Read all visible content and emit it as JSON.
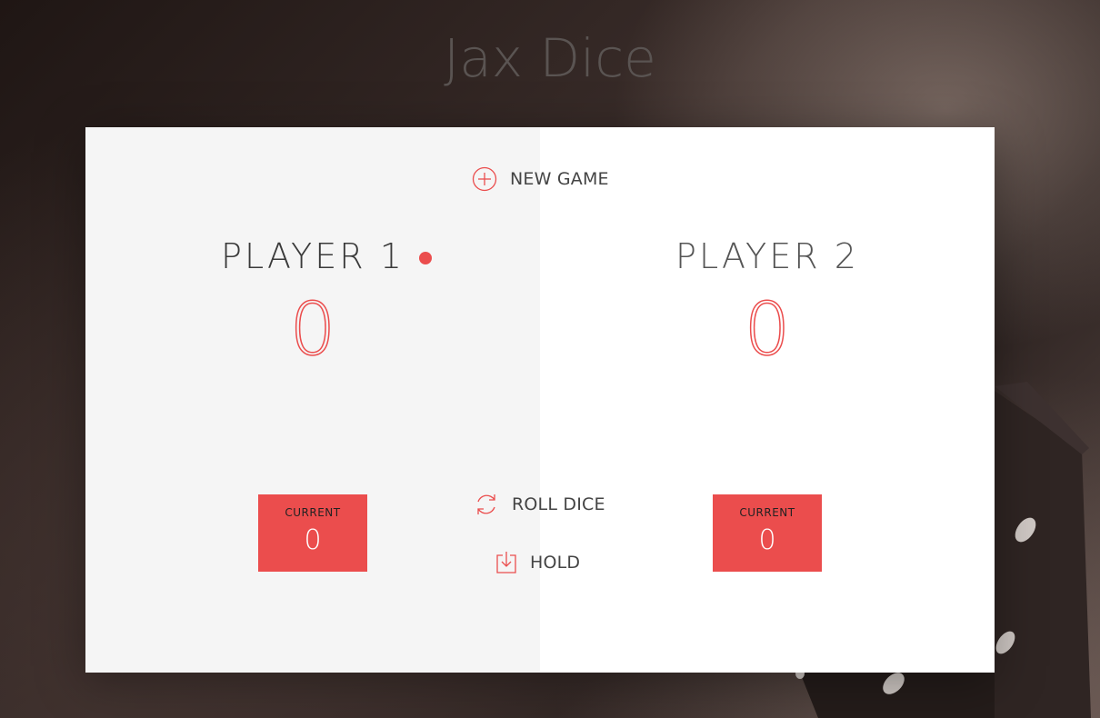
{
  "app": {
    "title": "Jax Dice"
  },
  "controls": {
    "new_game": {
      "label": "NEW GAME",
      "icon": "plus-circle-icon"
    },
    "roll_dice": {
      "label": "ROLL DICE",
      "icon": "refresh-icon"
    },
    "hold": {
      "label": "HOLD",
      "icon": "download-icon"
    }
  },
  "players": [
    {
      "name": "PLAYER 1",
      "score": "0",
      "current_label": "CURRENT",
      "current_score": "0",
      "active": true
    },
    {
      "name": "PLAYER 2",
      "score": "0",
      "current_label": "CURRENT",
      "current_score": "0",
      "active": false
    }
  ],
  "colors": {
    "accent": "#EB4D4D",
    "panel_active": "#f5f5f5",
    "panel_inactive": "#ffffff",
    "text": "#444444"
  }
}
